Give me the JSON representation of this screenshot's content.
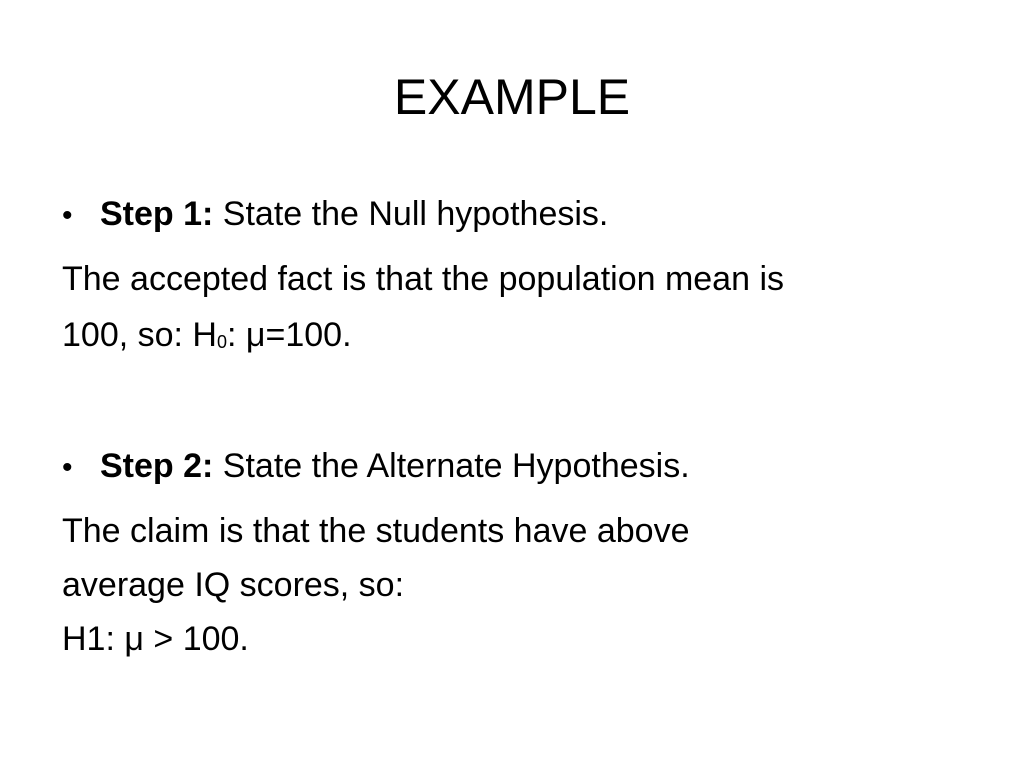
{
  "slide": {
    "title": "EXAMPLE",
    "step1": {
      "bullet": "•",
      "label": "Step 1:",
      "text": " State the Null hypothesis.",
      "body_line1": "The accepted fact is that the population mean is",
      "body_line2_prefix": "100, so: H",
      "body_line2_subscript": "0",
      "body_line2_suffix": ": μ=100."
    },
    "step2": {
      "bullet": "•",
      "label": "Step 2:",
      "text": " State the Alternate Hypothesis.",
      "body_line1": "The claim is that the students have above",
      "body_line2": "average IQ scores, so:",
      "body_line3": "H1: μ > 100."
    }
  }
}
